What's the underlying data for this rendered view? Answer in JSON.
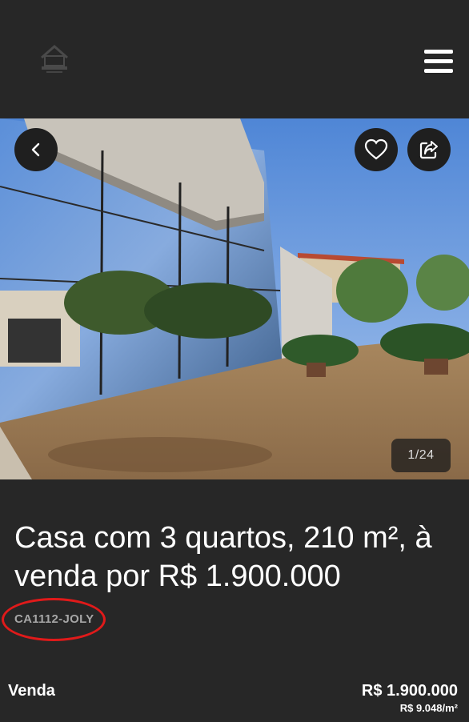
{
  "header": {
    "logo_icon": "house-logo-icon",
    "menu_icon": "hamburger-menu-icon"
  },
  "gallery": {
    "counter": "1/24",
    "back_icon": "chevron-left-icon",
    "favorite_icon": "heart-icon",
    "share_icon": "share-icon"
  },
  "listing": {
    "title": "Casa com 3 quartos, 210 m², à venda por R$ 1.900.000",
    "code": "CA1112-JOLY",
    "type": "Venda",
    "price": "R$ 1.900.000",
    "price_per_m2": "R$ 9.048/m²"
  },
  "colors": {
    "background": "#272727",
    "highlight": "#e01a1a"
  }
}
